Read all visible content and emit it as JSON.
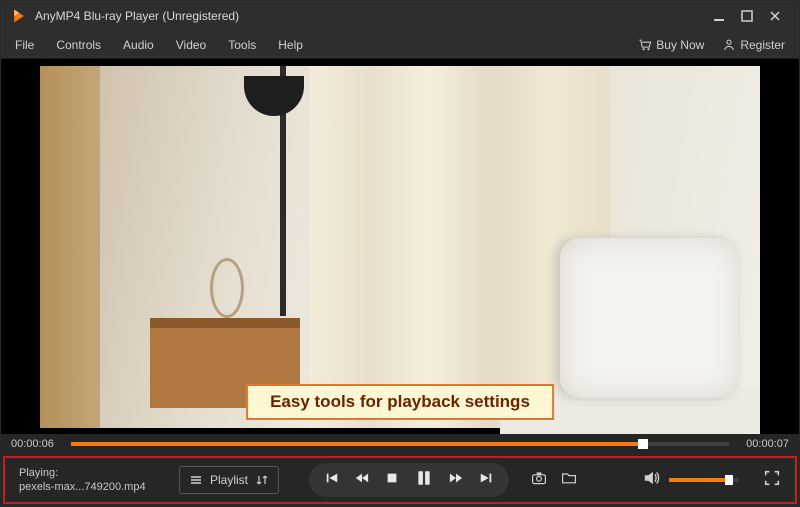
{
  "titlebar": {
    "title": "AnyMP4 Blu-ray Player (Unregistered)"
  },
  "menu": {
    "items": [
      "File",
      "Controls",
      "Audio",
      "Video",
      "Tools",
      "Help"
    ],
    "buy_now": "Buy Now",
    "register": "Register"
  },
  "annotation": {
    "text": "Easy tools for playback settings"
  },
  "progress": {
    "current": "00:00:06",
    "total": "00:00:07",
    "percent": "87",
    "accent": "#f77b0e"
  },
  "status": {
    "label": "Playing:",
    "file": "pexels-max...749200.mp4"
  },
  "playlist_btn": "Playlist",
  "volume": {
    "percent": "86"
  }
}
